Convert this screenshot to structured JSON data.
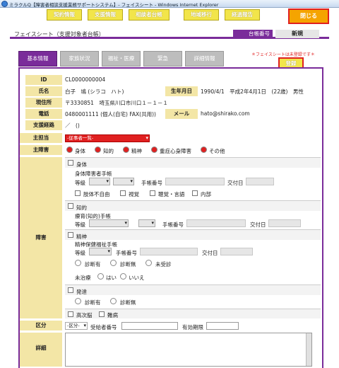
{
  "window": {
    "title": "ミラクルQ【障害者相談支援業務サポートシステム】- フェイスシート - Windows Internet Explorer"
  },
  "nav": {
    "buttons": [
      "契約情報",
      "支援情報",
      "相談者台帳",
      "地域移行",
      "経過報告"
    ],
    "close_label": "閉じる"
  },
  "header": {
    "title": "フェイスシート（支援対象者台帳）",
    "ledger_label": "台帳番号",
    "ledger_value": "新規"
  },
  "tabs": [
    "基本情報",
    "家族状況",
    "福祉・医療",
    "緊急",
    "詳細情報"
  ],
  "notice": "＊フェイスシートは未登録です＊",
  "register_label": "登録",
  "basic": {
    "id_label": "ID",
    "id_value": "CL0000000004",
    "name_label": "氏名",
    "name_value": "白子　鳩 (シラコ　ハト)",
    "dob_label": "生年月日",
    "dob_value": "1990/4/1　平成2年4月1日　(22歳)　男性",
    "addr_label": "現住所",
    "addr_value": "〒3330851　埼玉県川口市川口１－１－１",
    "tel_label": "電話",
    "tel_value": "0480001111 (個人(自宅)  FAX(共用))",
    "mail_label": "メール",
    "mail_value": "hato@shirako.com",
    "route_label": "支援経路",
    "route_value": "／　()"
  },
  "main": {
    "tanto_label": "主担当",
    "tanto_select": "-従事者一覧-",
    "disability_label": "主障害",
    "disability_options": [
      "身体",
      "知的",
      "精神",
      "重症心身障害",
      "その他"
    ]
  },
  "disability_section": {
    "label": "障害",
    "physical": "身体",
    "physical_book": "身体障害者手帳",
    "grade": "等級",
    "book_no": "手帳番号",
    "issue_date": "交付日",
    "physical_items": [
      "肢体不自由",
      "視覚",
      "聴覚・言語",
      "内部"
    ],
    "intellectual": "知的",
    "intellectual_book": "療育(知的)手帳",
    "mental": "精神",
    "mental_book": "精神保健福祉手帳",
    "diag_options": [
      "診断有",
      "診断無",
      "未受診"
    ],
    "untreated_label": "未治療",
    "untreated_options": [
      "はい",
      "いいえ"
    ],
    "development": "発達",
    "dev_diag_options": [
      "診断有",
      "診断無"
    ],
    "extra_items": [
      "高次脳",
      "難病"
    ]
  },
  "division": {
    "label": "区分",
    "select": "-区分-",
    "cert_label": "受給者番号",
    "period_label": "有効期限"
  },
  "detail": {
    "label": "詳細"
  },
  "colors": {
    "purple": "#7a2c9a",
    "yellow": "#f2e54a",
    "orange": "#f5a400",
    "red": "#e02020",
    "label_bg": "#f3e6a6"
  }
}
